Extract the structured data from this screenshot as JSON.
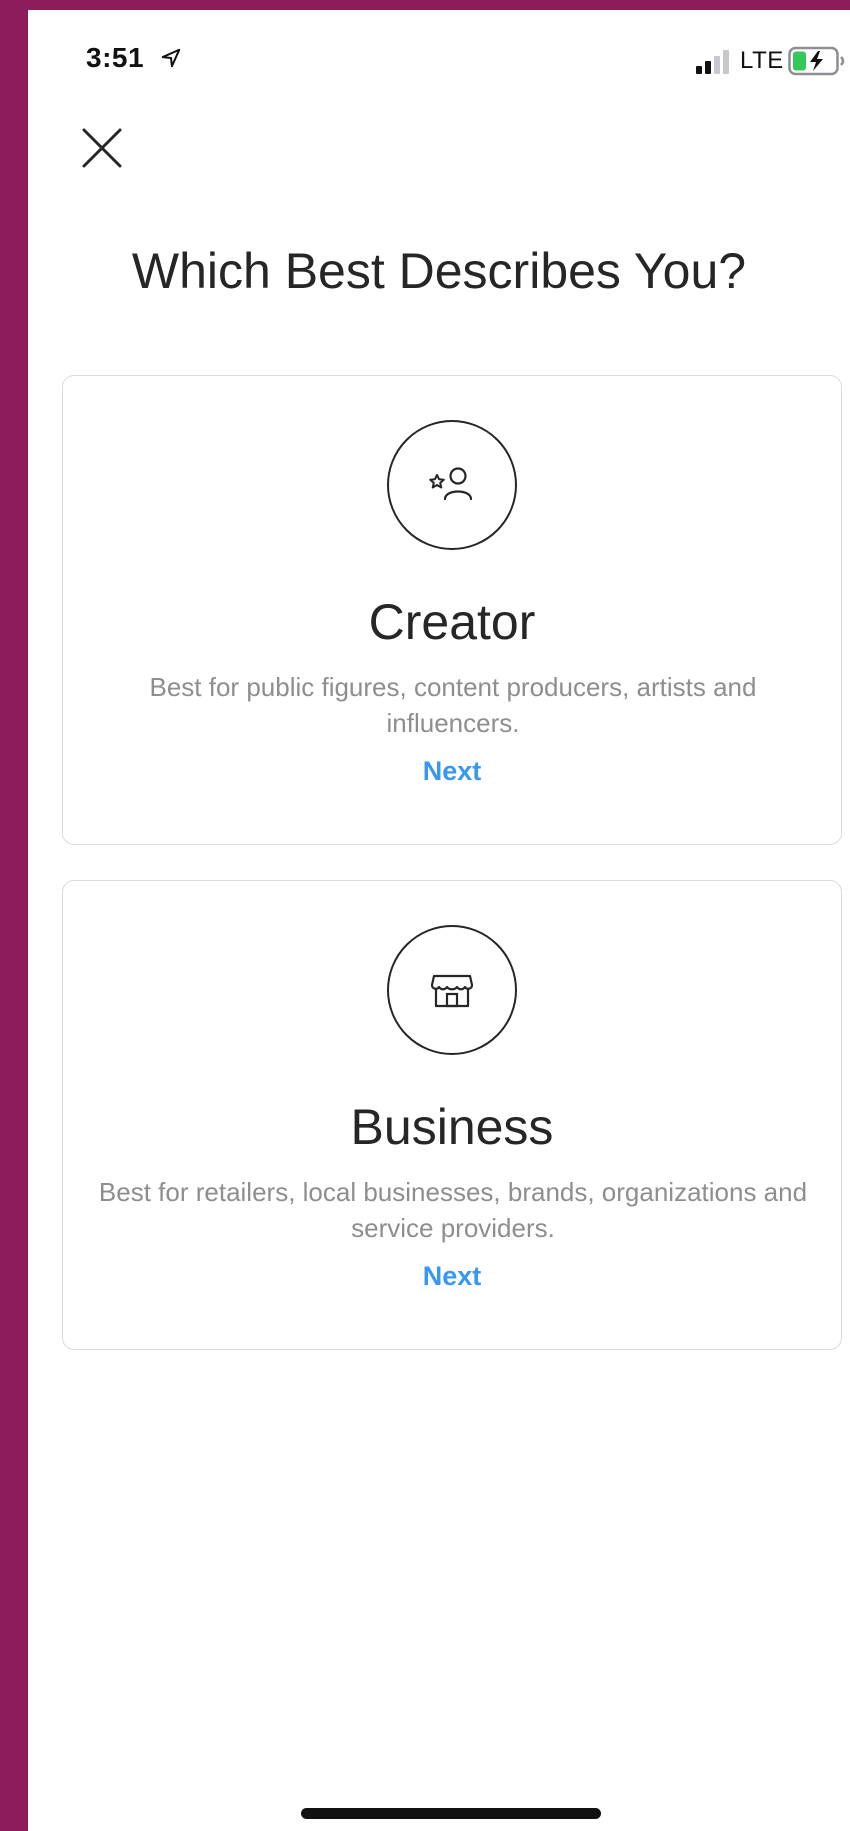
{
  "status_bar": {
    "time": "3:51",
    "carrier": "LTE",
    "icons": [
      "location-arrow-icon",
      "signal-bars-icon",
      "battery-charging-icon"
    ]
  },
  "header": {
    "close_icon": "close-icon",
    "title": "Which Best Describes You?"
  },
  "options": [
    {
      "icon": "creator-star-person-icon",
      "title": "Creator",
      "description": "Best for public figures, content producers, artists and influencers.",
      "action": "Next"
    },
    {
      "icon": "storefront-icon",
      "title": "Business",
      "description": "Best for retailers, local businesses, brands, organizations and service providers.",
      "action": "Next"
    }
  ],
  "colors": {
    "frame": "#8c1c5a",
    "accent": "#3897f0",
    "text_primary": "#262626",
    "text_secondary": "#8e8e8e",
    "border": "#dbdbdb"
  }
}
